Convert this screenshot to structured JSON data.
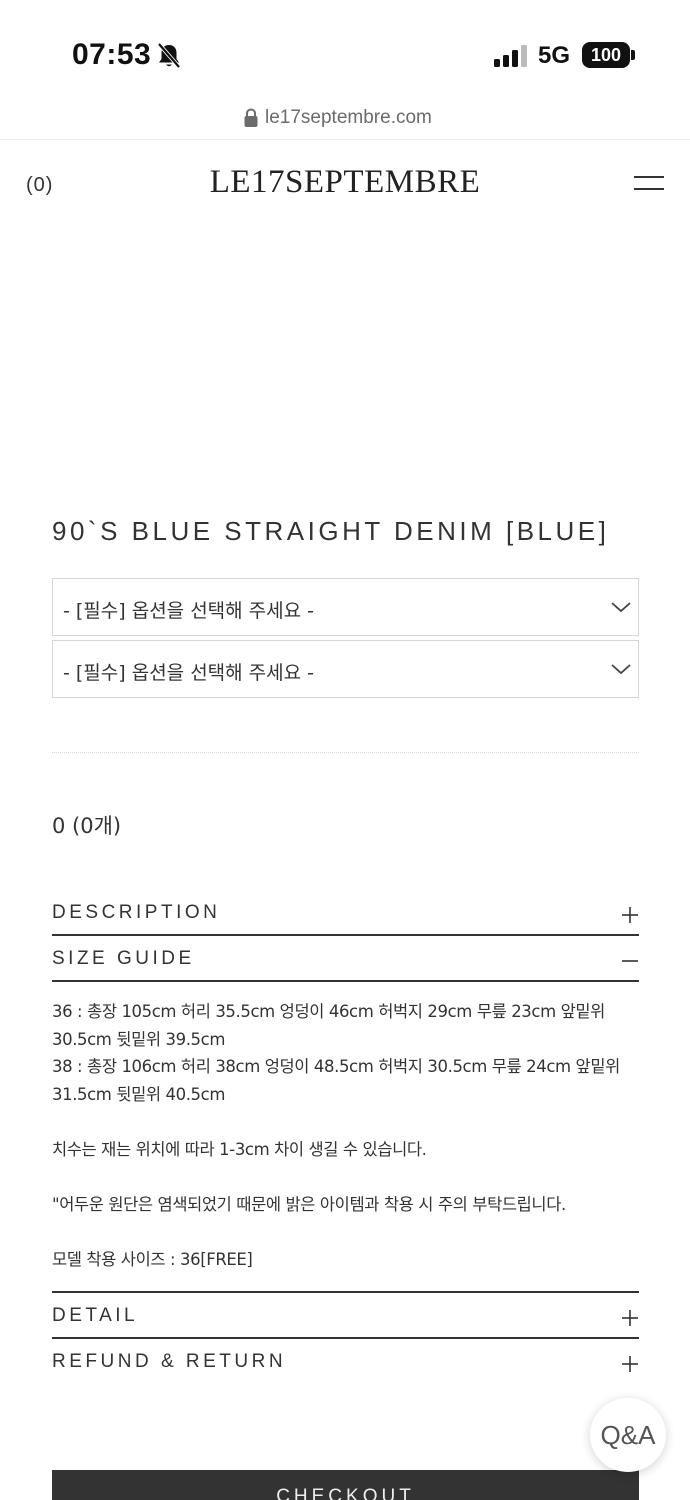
{
  "status_bar": {
    "time": "07:53",
    "network": "5G",
    "battery": "100",
    "icons": [
      "bell-off-icon",
      "signal-icon"
    ]
  },
  "browser": {
    "url": "le17septembre.com",
    "icons": [
      "lock-icon"
    ]
  },
  "header": {
    "cart_count": "(0)",
    "logo": "LE17SEPTEMBRE",
    "icons": [
      "menu-icon"
    ]
  },
  "product": {
    "title": "90`S BLUE STRAIGHT DENIM [BLUE]",
    "options": [
      {
        "placeholder": "- [필수] 옵션을 선택해 주세요 -"
      },
      {
        "placeholder": "- [필수] 옵션을 선택해 주세요 -"
      }
    ],
    "total": "0 (0개)"
  },
  "accordion": {
    "description": {
      "label": "DESCRIPTION",
      "state": "collapsed"
    },
    "size_guide": {
      "label": "SIZE GUIDE",
      "state": "expanded",
      "lines": [
        "36 : 총장 105cm 허리 35.5cm 엉덩이 46cm 허벅지 29cm 무릎 23cm 앞밑위 30.5cm 뒷밑위 39.5cm",
        "38 : 총장 106cm 허리 38cm 엉덩이 48.5cm 허벅지 30.5cm 무릎 24cm 앞밑위 31.5cm 뒷밑위 40.5cm",
        "치수는 재는 위치에 따라 1-3cm 차이 생길 수 있습니다.",
        "\"어두운 원단은 염색되었기 때문에 밝은 아이템과 착용 시 주의 부탁드립니다.",
        "모델 착용 사이즈 : 36[FREE]"
      ]
    },
    "detail": {
      "label": "DETAIL",
      "state": "collapsed"
    },
    "refund": {
      "label": "REFUND & RETURN",
      "state": "collapsed"
    }
  },
  "floating": {
    "qa_label": "Q&A"
  },
  "checkout": {
    "label": "CHECKOUT"
  },
  "colors": {
    "text": "#333333",
    "checkout_bg": "#333333",
    "border": "#d6d6d6"
  }
}
